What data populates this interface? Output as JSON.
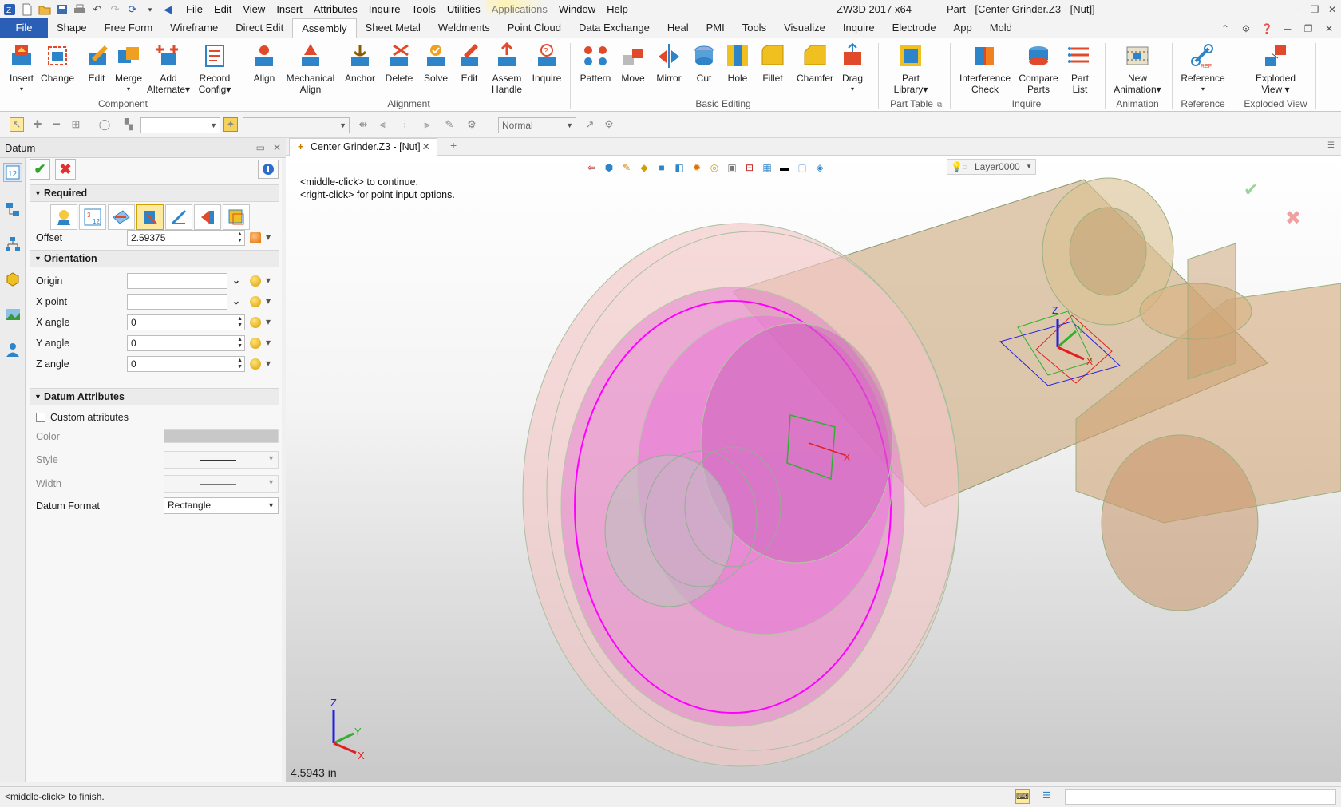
{
  "window": {
    "app_title": "ZW3D 2017  x64",
    "doc_title": "Part - [Center Grinder.Z3 - [Nut]]",
    "controls": [
      "minimize-icon",
      "restore-icon",
      "close-icon"
    ]
  },
  "menu": [
    "File",
    "Edit",
    "View",
    "Insert",
    "Attributes",
    "Inquire",
    "Tools",
    "Utilities",
    "Applications",
    "Window",
    "Help"
  ],
  "ribbon_tabs": [
    "File",
    "Shape",
    "Free Form",
    "Wireframe",
    "Direct Edit",
    "Assembly",
    "Sheet Metal",
    "Weldments",
    "Point Cloud",
    "Data Exchange",
    "Heal",
    "PMI",
    "Tools",
    "Visualize",
    "Inquire",
    "Electrode",
    "App",
    "Mold"
  ],
  "active_tab": "Assembly",
  "ribbon": {
    "component": {
      "label": "Component",
      "insert": "Insert",
      "change": "Change",
      "edit": "Edit",
      "merge": "Merge",
      "add_alternate_1": "Add",
      "add_alternate_2": "Alternate",
      "record_config_1": "Record",
      "record_config_2": "Config"
    },
    "alignment": {
      "label": "Alignment",
      "align": "Align",
      "mech_align_1": "Mechanical",
      "mech_align_2": "Align",
      "anchor": "Anchor",
      "delete": "Delete",
      "solve": "Solve",
      "edit": "Edit",
      "assem_handle_1": "Assem",
      "assem_handle_2": "Handle",
      "inquire": "Inquire"
    },
    "basic_editing": {
      "label": "Basic Editing",
      "pattern": "Pattern",
      "move": "Move",
      "mirror": "Mirror",
      "cut": "Cut",
      "hole": "Hole",
      "fillet": "Fillet",
      "chamfer": "Chamfer",
      "drag": "Drag"
    },
    "part_table": {
      "label": "Part Table",
      "part_library_1": "Part",
      "part_library_2": "Library"
    },
    "inquire": {
      "label": "Inquire",
      "interference_1": "Interference",
      "interference_2": "Check",
      "compare_1": "Compare",
      "compare_2": "Parts",
      "part_list_1": "Part",
      "part_list_2": "List"
    },
    "animation": {
      "label": "Animation",
      "new_anim_1": "New",
      "new_anim_2": "Animation"
    },
    "reference": {
      "label": "Reference",
      "reference": "Reference"
    },
    "exploded_view": {
      "label": "Exploded View",
      "exploded_1": "Exploded",
      "exploded_2": "View"
    }
  },
  "toolbar2": {
    "render_mode": "Normal"
  },
  "panel": {
    "title": "Datum",
    "required": {
      "header": "Required",
      "offset_label": "Offset",
      "offset_value": "2.59375"
    },
    "orientation": {
      "header": "Orientation",
      "origin_label": "Origin",
      "origin_value": "",
      "xpoint_label": "X point",
      "xpoint_value": "",
      "xangle_label": "X angle",
      "xangle_value": "0",
      "yangle_label": "Y angle",
      "yangle_value": "0",
      "zangle_label": "Z angle",
      "zangle_value": "0"
    },
    "attributes": {
      "header": "Datum Attributes",
      "custom_label": "Custom attributes",
      "color_label": "Color",
      "style_label": "Style",
      "width_label": "Width",
      "format_label": "Datum Format",
      "format_value": "Rectangle"
    }
  },
  "document_tab": "Center Grinder.Z3 - [Nut]",
  "viewport": {
    "prompt_line1": "<middle-click> to continue.",
    "prompt_line2": "<right-click> for point input options.",
    "layer": "Layer0000",
    "measurement": "4.5943 in",
    "axis_labels": {
      "x": "X",
      "y": "Y",
      "z": "Z"
    }
  },
  "status": {
    "message": "<middle-click> to finish."
  }
}
